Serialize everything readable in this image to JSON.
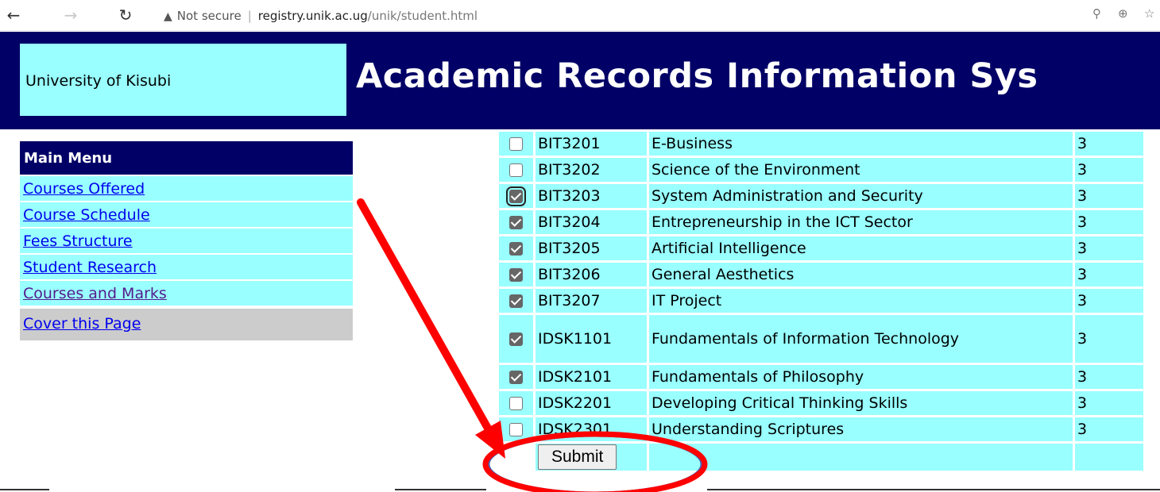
{
  "browser": {
    "back_icon": "arrow-left",
    "forward_icon": "arrow-right",
    "reload_icon": "reload",
    "security_label": "Not secure",
    "url_host": "registry.unik.ac.ug",
    "url_path": "/unik/student.html"
  },
  "header": {
    "university": "University of Kisubi",
    "title": "Academic Records Information Sys",
    "bg_color": "#000066",
    "box_color": "#99ffff"
  },
  "menu": {
    "heading": "Main Menu",
    "items": [
      {
        "label": "Courses Offered"
      },
      {
        "label": "Course Schedule"
      },
      {
        "label": "Fees Structure"
      },
      {
        "label": "Student Research"
      },
      {
        "label": "Courses and Marks"
      }
    ],
    "footer_link": "Cover this Page"
  },
  "courses": [
    {
      "code": "BIT3201",
      "title": "E-Business",
      "units": "3",
      "checked": false
    },
    {
      "code": "BIT3202",
      "title": "Science of the Environment",
      "units": "3",
      "checked": false
    },
    {
      "code": "BIT3203",
      "title": "System Administration and Security",
      "units": "3",
      "checked": true
    },
    {
      "code": "BIT3204",
      "title": "Entrepreneurship in the ICT Sector",
      "units": "3",
      "checked": true
    },
    {
      "code": "BIT3205",
      "title": "Artificial Intelligence",
      "units": "3",
      "checked": true
    },
    {
      "code": "BIT3206",
      "title": "General Aesthetics",
      "units": "3",
      "checked": true
    },
    {
      "code": "BIT3207",
      "title": "IT Project",
      "units": "3",
      "checked": true
    },
    {
      "code": "IDSK1101",
      "title": "Fundamentals of Information Technology",
      "units": "3",
      "checked": true
    },
    {
      "code": "IDSK2101",
      "title": "Fundamentals of Philosophy",
      "units": "3",
      "checked": true
    },
    {
      "code": "IDSK2201",
      "title": "Developing Critical Thinking Skills",
      "units": "3",
      "checked": false
    },
    {
      "code": "IDSK2301",
      "title": "Understanding Scriptures",
      "units": "3",
      "checked": false
    }
  ],
  "submit_label": "Submit",
  "annotation": {
    "color": "#ff0000",
    "ellipse_fill": "#9ae9ff"
  }
}
